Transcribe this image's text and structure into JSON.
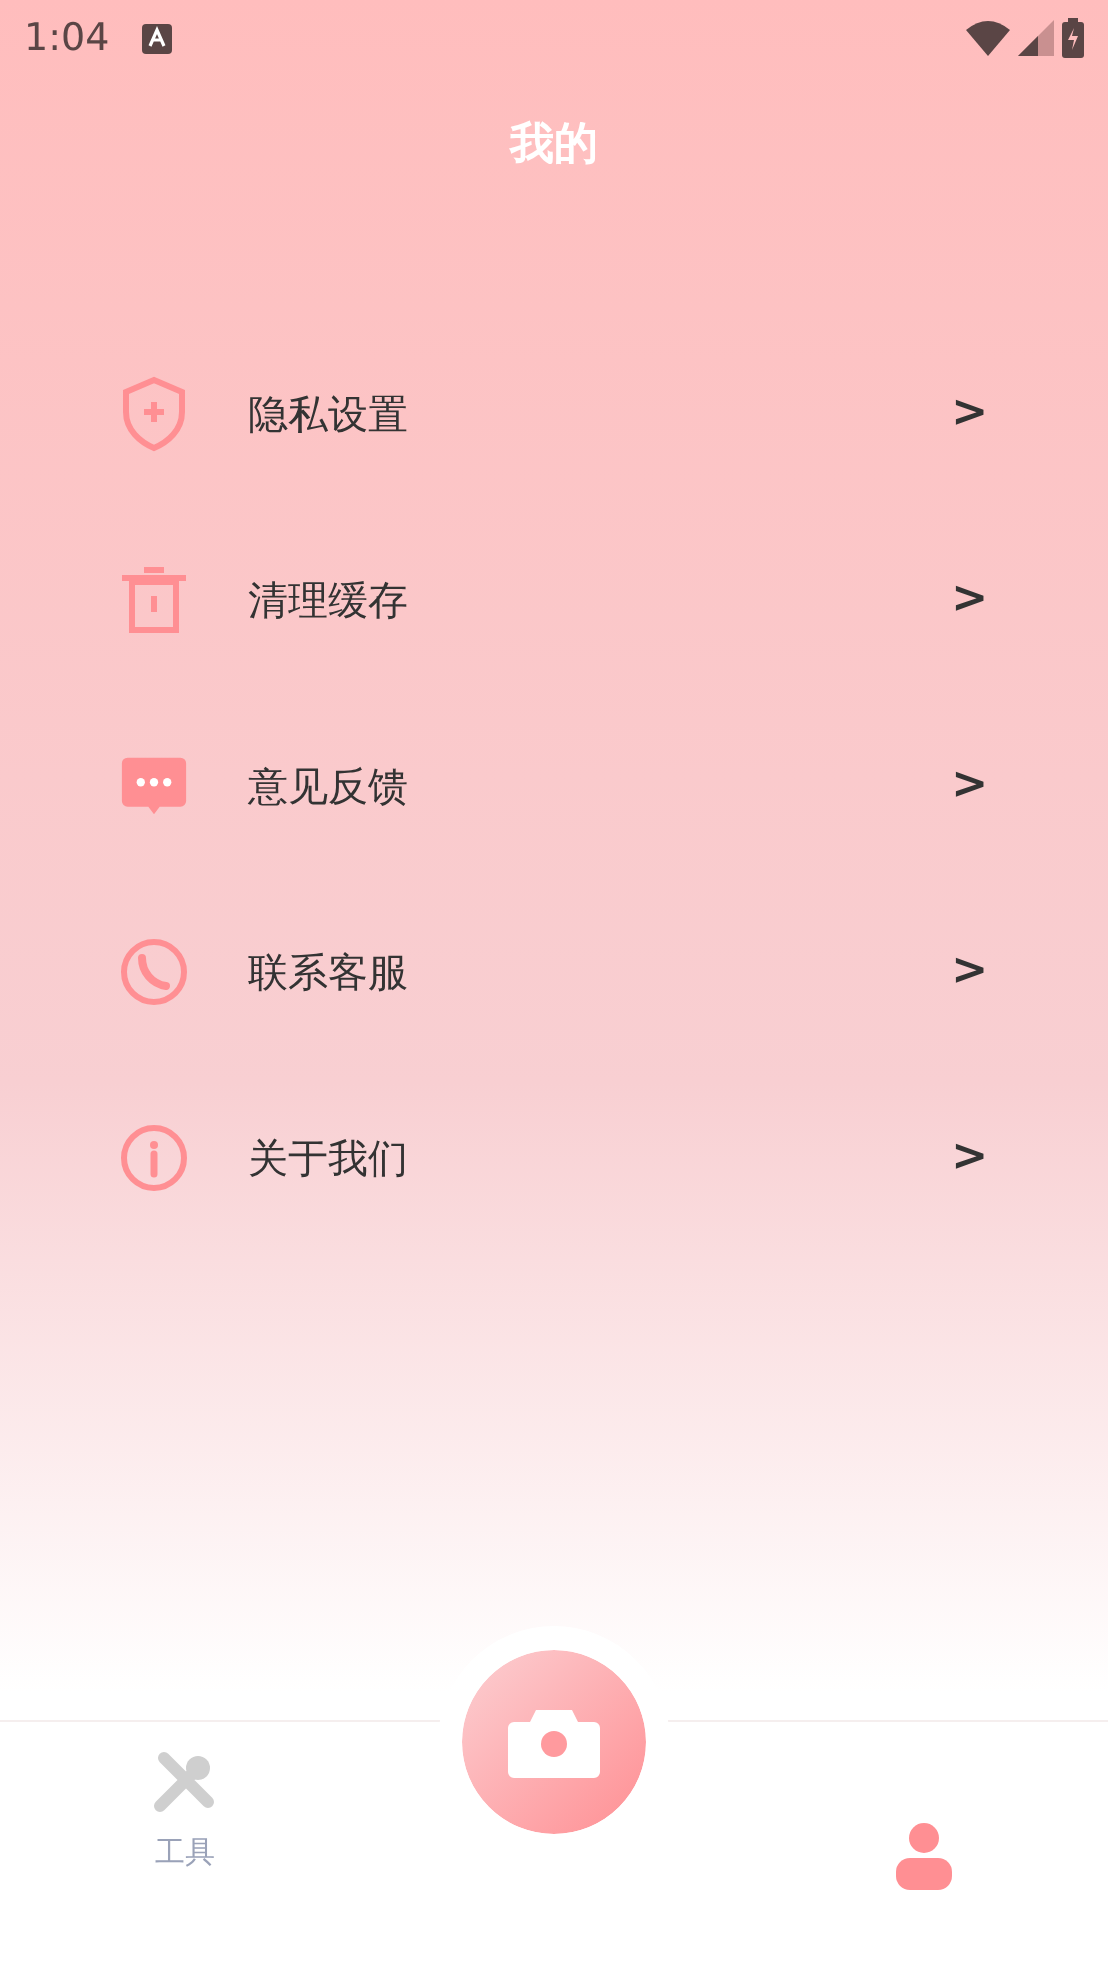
{
  "status_bar": {
    "time": "1:04"
  },
  "title": "我的",
  "menu": [
    {
      "kind": "shield",
      "label": "隐私设置",
      "chevron": ">"
    },
    {
      "kind": "trash",
      "label": "清理缓存",
      "chevron": ">"
    },
    {
      "kind": "chat",
      "label": "意见反馈",
      "chevron": ">"
    },
    {
      "kind": "phone",
      "label": "联系客服",
      "chevron": ">"
    },
    {
      "kind": "info",
      "label": "关于我们",
      "chevron": ">"
    }
  ],
  "tabs": [
    {
      "kind": "tools",
      "label": "工具",
      "selected": false
    },
    {
      "kind": "camera",
      "selected": false
    },
    {
      "kind": "person",
      "selected": true
    }
  ]
}
